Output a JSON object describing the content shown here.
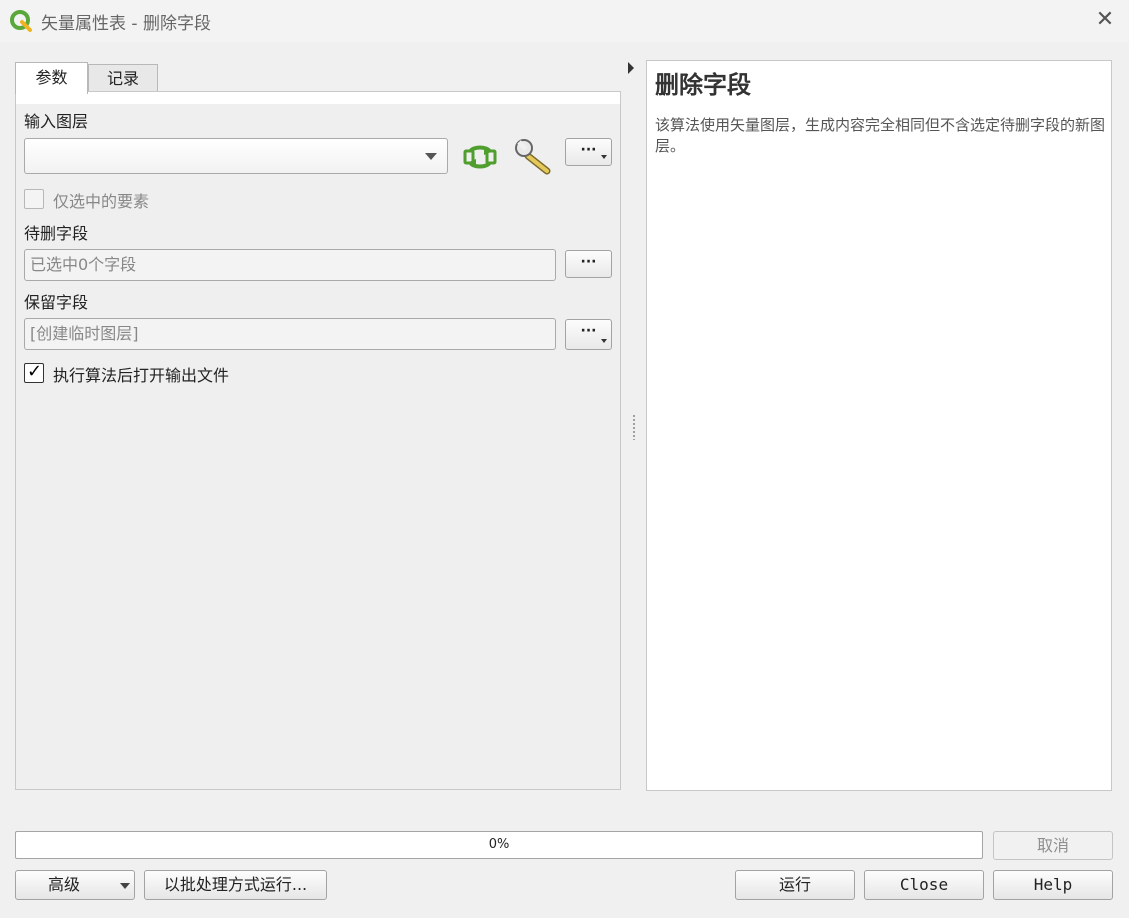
{
  "window": {
    "title": "矢量属性表 - 删除字段",
    "close_glyph": "✕"
  },
  "tabs": [
    {
      "label": "参数",
      "active": true
    },
    {
      "label": "记录",
      "active": false
    }
  ],
  "params": {
    "input_layer_label": "输入图层",
    "input_layer_value": "",
    "selected_only_label": "仅选中的要素",
    "selected_only_checked": false,
    "fields_to_drop_label": "待删字段",
    "fields_to_drop_value": "已选中0个字段",
    "retained_fields_label": "保留字段",
    "retained_fields_value": "[创建临时图层]",
    "open_output_label": "执行算法后打开输出文件",
    "open_output_checked": true,
    "dots": "···"
  },
  "help": {
    "title": "删除字段",
    "body": "该算法使用矢量图层，生成内容完全相同但不含选定待删字段的新图层。"
  },
  "footer": {
    "progress_percent": 0,
    "progress_label": "0%",
    "cancel_label": "取消",
    "advanced_label": "高级",
    "batch_label": "以批处理方式运行...",
    "run_label": "运行",
    "close_label": "Close",
    "help_label": "Help"
  },
  "icons": [
    "qgis-icon",
    "refresh-icon",
    "wrench-icon",
    "close-icon"
  ],
  "colors": {
    "accent_green": "#5aa83a",
    "qgis_yellow": "#f0b323"
  }
}
